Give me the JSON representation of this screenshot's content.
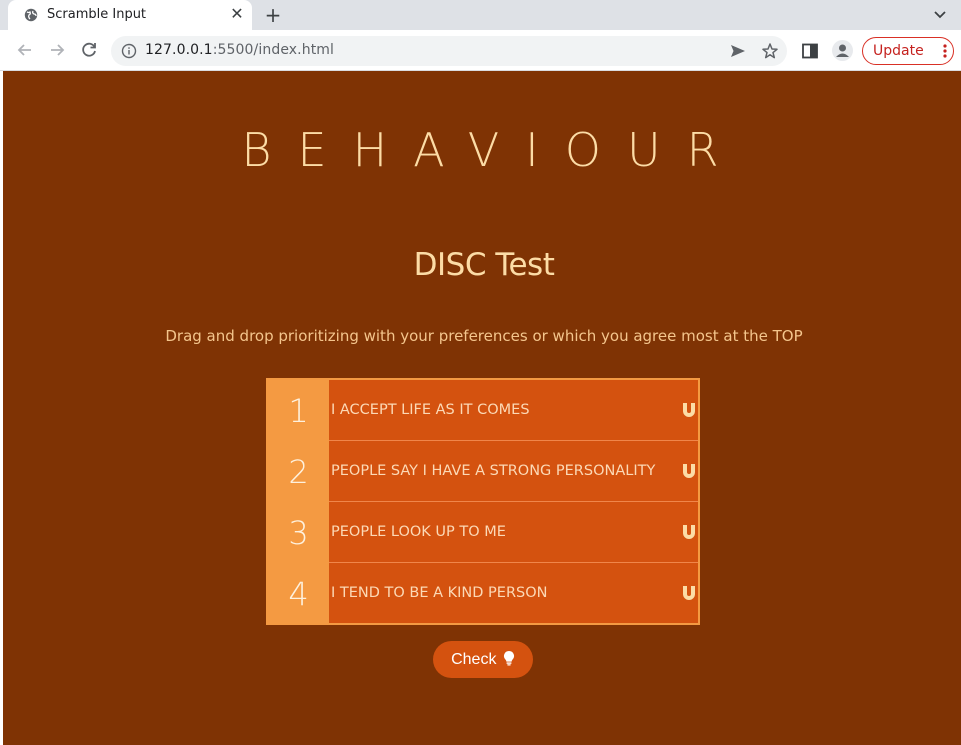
{
  "browser": {
    "tab_title": "Scramble Input",
    "url_host": "127.0.0.1",
    "url_rest": ":5500/index.html",
    "update_label": "Update"
  },
  "page": {
    "brand": "BEHAVIOUR",
    "title": "DISC Test",
    "instructions": "Drag and drop prioritizing with your preferences or which you agree most at the TOP",
    "items": [
      {
        "rank": "1",
        "text": "I ACCEPT LIFE AS IT COMES"
      },
      {
        "rank": "2",
        "text": "PEOPLE SAY I HAVE A STRONG PERSONALITY"
      },
      {
        "rank": "3",
        "text": "PEOPLE LOOK UP TO ME"
      },
      {
        "rank": "4",
        "text": "I TEND TO BE A KIND PERSON"
      }
    ],
    "check_label": "Check"
  },
  "colors": {
    "page_bg": "#7f3304",
    "accent": "#d4520f",
    "number_column": "#f49a42",
    "heading_text": "#fcdca6"
  },
  "icons": {
    "tab_favicon": "globe-icon",
    "drag_handle": "magnet-icon",
    "check": "lightbulb-icon"
  }
}
